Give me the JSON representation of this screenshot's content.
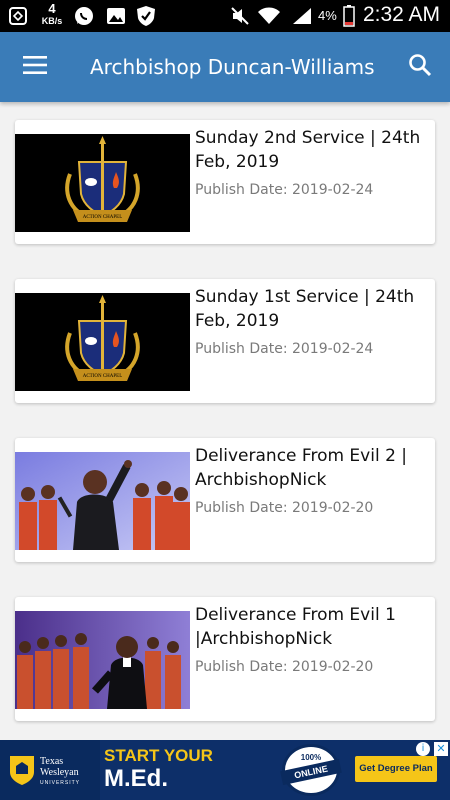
{
  "status_bar": {
    "network_speed_value": "4",
    "network_speed_unit": "KB/s",
    "battery_percent": "4%",
    "time": "2:32 AM"
  },
  "app_bar": {
    "title": "Archbishop Duncan-Williams",
    "menu_icon": "hamburger-menu-icon",
    "search_icon": "search-icon",
    "color": "#3a7cb8"
  },
  "videos": [
    {
      "title": "Sunday 2nd Service | 24th Feb, 2019",
      "publish_date": "Publish Date: 2019-02-24",
      "thumbnail": "action-chapel-logo"
    },
    {
      "title": "Sunday 1st Service | 24th Feb, 2019",
      "publish_date": "Publish Date: 2019-02-24",
      "thumbnail": "action-chapel-logo"
    },
    {
      "title": "Deliverance From Evil 2 | ArchbishopNick",
      "publish_date": "Publish Date: 2019-02-20",
      "thumbnail": "preacher-with-choir-photo"
    },
    {
      "title": "Deliverance From Evil 1 |ArchbishopNick",
      "publish_date": "Publish Date: 2019-02-20",
      "thumbnail": "preacher-with-choir-photo"
    }
  ],
  "ad": {
    "university_name": "Texas Wesleyan",
    "university_sub": "UNIVERSITY",
    "headline_line1": "START YOUR",
    "headline_line2": "M.Ed.",
    "badge_top": "100%",
    "badge_main": "ONLINE",
    "cta_label": "Get Degree Plan",
    "info_symbol": "i",
    "close_symbol": "✕"
  },
  "colors": {
    "app_bar": "#3a7cb8",
    "background": "#f2f2f2",
    "ad_navy": "#0d2f69",
    "ad_gold": "#f5c518"
  }
}
